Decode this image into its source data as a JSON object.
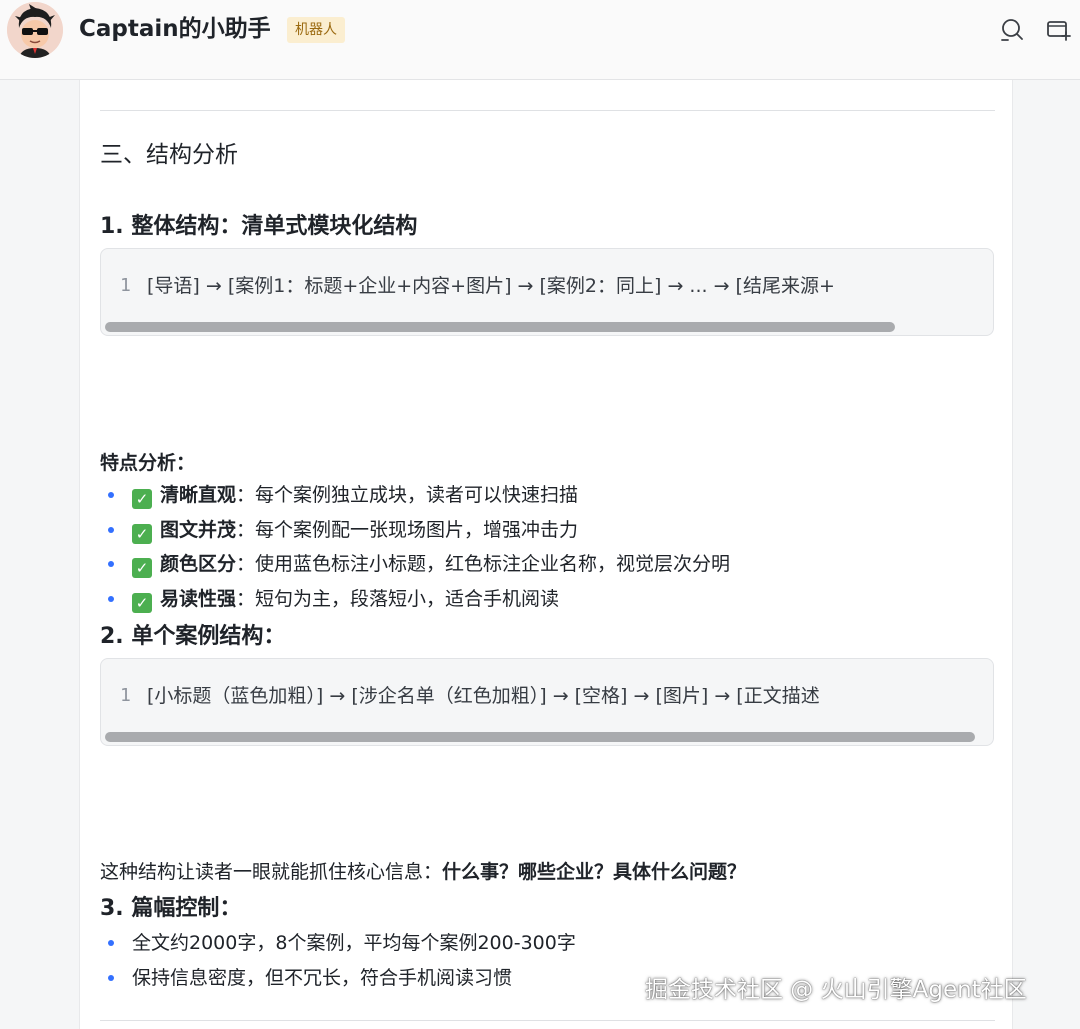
{
  "header": {
    "title": "Captain的小助手",
    "badge": "机器人",
    "icons": [
      "search-icon",
      "new-chat-icon"
    ]
  },
  "content": {
    "section_title": "三、结构分析",
    "overall": {
      "heading": "1. 整体结构：清单式模块化结构",
      "code_line_number": "1",
      "code_text": "[导语] → [案例1：标题+企业+内容+图片] → [案例2：同上] → ... → [结尾来源+"
    },
    "features": {
      "title": "特点分析：",
      "items": [
        {
          "bold": "清晰直观",
          "text": "：每个案例独立成块，读者可以快速扫描"
        },
        {
          "bold": "图文并茂",
          "text": "：每个案例配一张现场图片，增强冲击力"
        },
        {
          "bold": "颜色区分",
          "text": "：使用蓝色标注小标题，红色标注企业名称，视觉层次分明"
        },
        {
          "bold": "易读性强",
          "text": "：短句为主，段落短小，适合手机阅读"
        }
      ]
    },
    "single_case": {
      "heading": "2. 单个案例结构：",
      "code_line_number": "1",
      "code_text": "[小标题（蓝色加粗）] → [涉企名单（红色加粗）] → [空格] → [图片] → [正文描述"
    },
    "summary": {
      "prefix": "这种结构让读者一眼就能抓住核心信息：",
      "bold": "什么事？哪些企业？具体什么问题？"
    },
    "length": {
      "heading": "3. 篇幅控制：",
      "items": [
        {
          "text": "全文约2000字，8个案例，平均每个案例200-300字"
        },
        {
          "text": "保持信息密度，但不冗长，符合手机阅读习惯"
        }
      ]
    }
  },
  "watermark": "掘金技术社区 @ 火山引擎Agent社区",
  "colors": {
    "bullet": "#3370ff",
    "badge_bg": "#fbeed0",
    "badge_text": "#9b6a10",
    "check": "#4caf50"
  }
}
